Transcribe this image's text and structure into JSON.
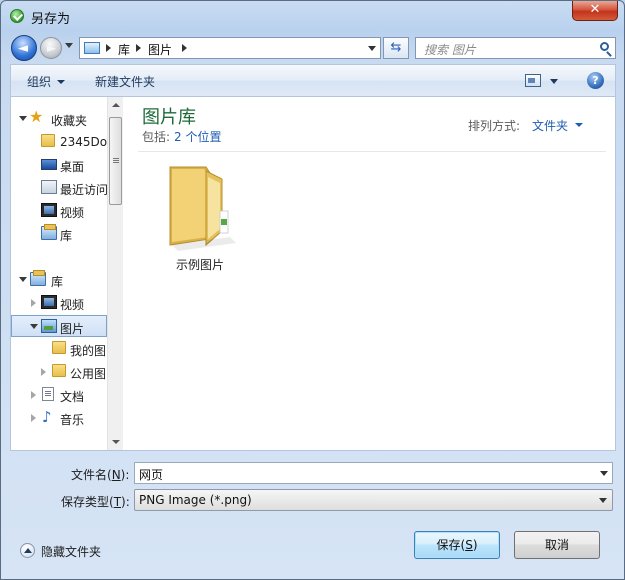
{
  "window": {
    "title": "另存为",
    "close_glyph": "✕"
  },
  "nav": {
    "back_glyph": "◄",
    "forward_glyph": "►"
  },
  "address": {
    "crumbs": [
      "库",
      "图片"
    ],
    "refresh_glyph": "⇆"
  },
  "search": {
    "placeholder": "搜索 图片"
  },
  "toolbar": {
    "organize": "组织",
    "new_folder": "新建文件夹",
    "help_glyph": "?"
  },
  "tree": {
    "items": [
      {
        "label": "收藏夹",
        "icon": "star-icon"
      },
      {
        "label": "2345Do",
        "icon": "folder-icon"
      },
      {
        "label": "桌面",
        "icon": "desktop-icon"
      },
      {
        "label": "最近访问",
        "icon": "recent-places-icon"
      },
      {
        "label": "视频",
        "icon": "video-icon"
      },
      {
        "label": "库",
        "icon": "library-icon"
      },
      {
        "label": "库",
        "icon": "library-icon"
      },
      {
        "label": "视频",
        "icon": "video-icon"
      },
      {
        "label": "图片",
        "icon": "pictures-icon"
      },
      {
        "label": "我的图",
        "icon": "folder-icon"
      },
      {
        "label": "公用图",
        "icon": "folder-icon"
      },
      {
        "label": "文档",
        "icon": "document-icon"
      },
      {
        "label": "音乐",
        "icon": "music-icon"
      }
    ]
  },
  "library": {
    "title": "图片库",
    "includes_label": "包括:",
    "includes_link": "2 个位置",
    "sort_label": "排列方式:",
    "sort_value": "文件夹"
  },
  "files": [
    {
      "name": "示例图片",
      "icon": "folder-icon"
    }
  ],
  "form": {
    "filename_label": "文件名(",
    "filename_key": "N",
    "filename_suffix": "):",
    "filename_value": "网页",
    "filetype_label": "保存类型(",
    "filetype_key": "T",
    "filetype_suffix": "):",
    "filetype_value": "PNG Image (*.png)"
  },
  "footer": {
    "hide_folders": "隐藏文件夹",
    "save_label": "保存(",
    "save_key": "S",
    "save_suffix": ")",
    "cancel_label": "取消"
  },
  "colors": {
    "accent": "#1f5cb3",
    "library_title": "#1e6a3a",
    "close": "#c1341c"
  }
}
